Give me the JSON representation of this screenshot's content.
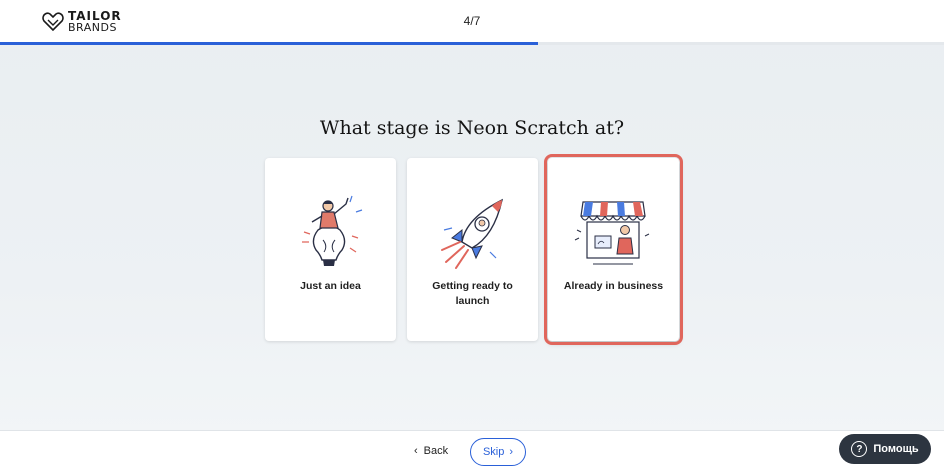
{
  "header": {
    "logo_top": "TAILOR",
    "logo_bottom": "BRANDS",
    "step": "4/7",
    "progress": 0.57
  },
  "question": "What stage is Neon Scratch at?",
  "options": [
    {
      "label": "Just an idea",
      "icon": "lightbulb-person-icon",
      "selected": false
    },
    {
      "label": "Getting ready to launch",
      "icon": "rocket-icon",
      "selected": false
    },
    {
      "label": "Already in business",
      "icon": "storefront-icon",
      "selected": true
    }
  ],
  "footer": {
    "back_label": "Back",
    "skip_label": "Skip"
  },
  "help": {
    "label": "Помощь"
  },
  "colors": {
    "accent": "#2a60d8",
    "selected_outline": "#e0665c",
    "help_bg": "#2d3540"
  }
}
